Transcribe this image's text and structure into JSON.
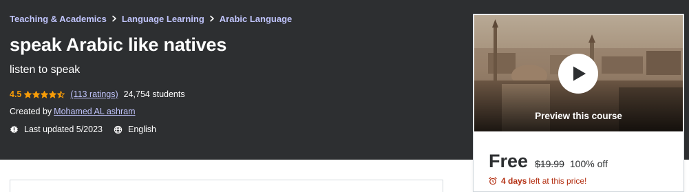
{
  "breadcrumb": [
    {
      "label": "Teaching & Academics"
    },
    {
      "label": "Language Learning"
    },
    {
      "label": "Arabic Language"
    }
  ],
  "course": {
    "title": "speak Arabic like natives",
    "subtitle": "listen to speak",
    "rating": "4.5",
    "rating_value": 4.5,
    "ratings_link": "(113 ratings)",
    "students": "24,754 students",
    "created_by_label": "Created by",
    "author": "Mohamed AL ashram",
    "last_updated": "Last updated 5/2023",
    "language": "English"
  },
  "sidebar": {
    "preview_label": "Preview this course",
    "price_current": "Free",
    "price_original": "$19.99",
    "discount": "100% off",
    "deadline_days": "4 days",
    "deadline_rest": "left at this price!"
  },
  "icons": {
    "breadcrumb_separator": "chevron-right-icon",
    "star": "star-icon",
    "updated": "alert-badge-icon",
    "language": "globe-icon",
    "play": "play-icon",
    "deadline": "alarm-clock-icon"
  },
  "colors": {
    "hero_bg": "#2d2f31",
    "link": "#c0c4fc",
    "star": "#f69c08",
    "urgent": "#b32d0f",
    "text_dark": "#2d2f31"
  }
}
